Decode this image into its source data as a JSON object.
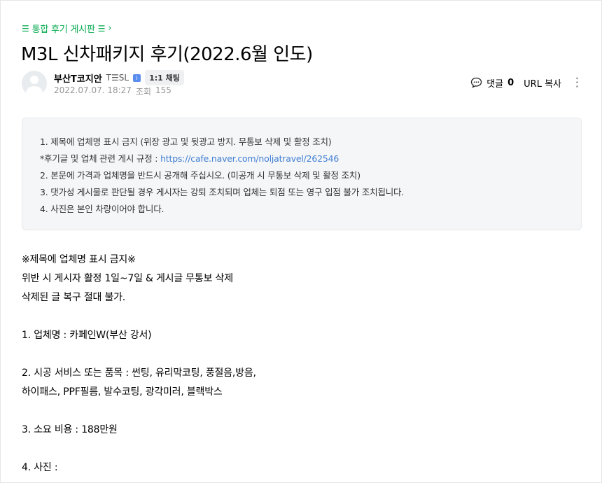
{
  "board": {
    "menu_icon": "☰",
    "label": "통합 후기 게시판",
    "menu_icon_right": "☰",
    "chevron": "›"
  },
  "post": {
    "title": "M3L 신차패키지 후기(2022.6월 인도)"
  },
  "author": {
    "nickname": "부산T코지안",
    "level": "T☰SL",
    "level_icon": "i",
    "chat_label": "1:1 채팅",
    "date": "2022.07.07. 18:27",
    "views_label": "조회",
    "views": "155"
  },
  "tools": {
    "comment_icon": "comment-bubble-icon",
    "comment_label": "댓글",
    "comment_count": "0",
    "url_copy_label": "URL 복사",
    "more_icon": "⋮"
  },
  "notice": {
    "line1": "1. 제목에 업체명 표시 금지 (위장 광고 및 뒷광고 방지. 무통보 삭제 및 활정 조치)",
    "line2_prefix": "*후기글 및 업체 관련 게시 규정 : ",
    "line2_link": "https://cafe.naver.com/noljatravel/262546",
    "line3": "2. 본문에 가격과 업체명을 반드시 공개해 주십시오. (미공개 시 무통보 삭제 및 활정 조치)",
    "line4": "3. 댓가성 게시물로 판단될 경우 게시자는 강퇴 조치되며 업체는 퇴점 또는 영구 입점 불가 조치됩니다.",
    "line5": "4. 사진은 본인 차량이어야 합니다."
  },
  "content": {
    "l1": "※제목에 업체명 표시 금지※",
    "l2": "위반 시 게시자 활정 1일~7일 & 게시글 무통보 삭제",
    "l3": "삭제된 글 복구 절대 불가.",
    "l4": "1. 업체명 :  카페인W(부산 강서)",
    "l5": "2. 시공 서비스 또는 품목 :  썬팅, 유리막코팅, 풍절음,방음,",
    "l6": "하이패스, PPF필름, 발수코팅, 광각미러, 블랙박스",
    "l7": "3. 소요 비용 :  188만원",
    "l8": "4. 사진 :"
  },
  "colors": {
    "accent_green": "#03a94d",
    "link_blue": "#3f7ed3",
    "notice_bg": "#f5f6f8"
  }
}
